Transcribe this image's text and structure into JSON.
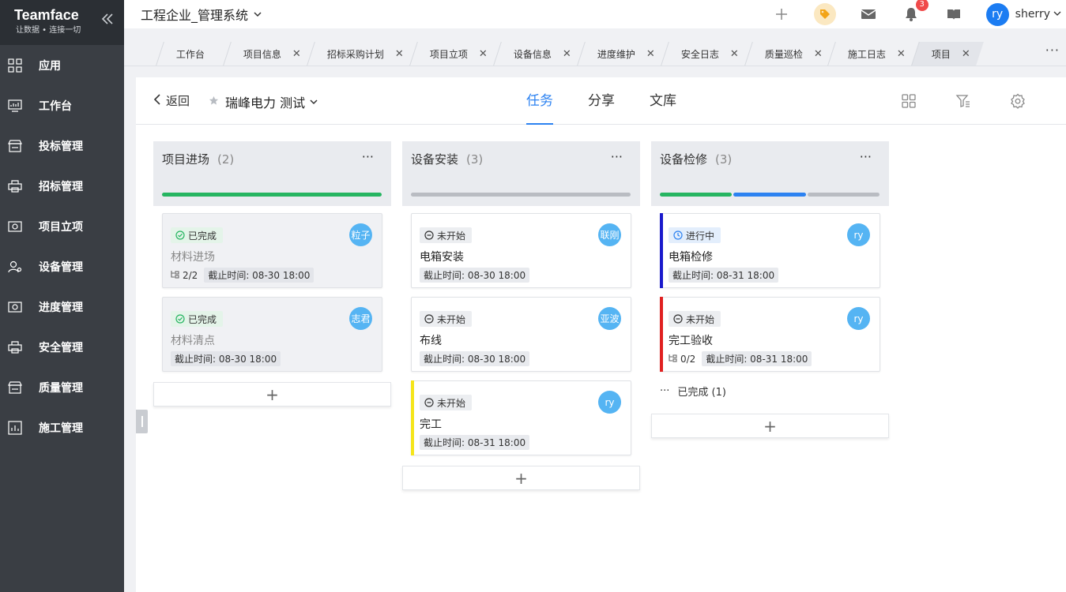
{
  "brand": {
    "name": "Teamface",
    "slogan": "让数据 • 连接一切"
  },
  "sidebar": {
    "items": [
      {
        "label": "应用",
        "icon": "grid-apps-icon"
      },
      {
        "label": "工作台",
        "icon": "dashboard-icon"
      },
      {
        "label": "投标管理",
        "icon": "storefront-icon"
      },
      {
        "label": "招标管理",
        "icon": "printer-icon"
      },
      {
        "label": "项目立项",
        "icon": "projector-icon"
      },
      {
        "label": "设备管理",
        "icon": "user-gear-icon"
      },
      {
        "label": "进度管理",
        "icon": "projector-icon"
      },
      {
        "label": "安全管理",
        "icon": "printer-icon"
      },
      {
        "label": "质量管理",
        "icon": "storefront-icon"
      },
      {
        "label": "施工管理",
        "icon": "chart-icon"
      }
    ]
  },
  "topbar": {
    "system_title": "工程企业_管理系统",
    "notification_count": "3",
    "user_initials": "ry",
    "user_name": "sherry"
  },
  "tabs": [
    {
      "label": "工作台",
      "closable": false
    },
    {
      "label": "项目信息",
      "closable": true
    },
    {
      "label": "招标采购计划",
      "closable": true
    },
    {
      "label": "项目立项",
      "closable": true
    },
    {
      "label": "设备信息",
      "closable": true
    },
    {
      "label": "进度维护",
      "closable": true
    },
    {
      "label": "安全日志",
      "closable": true
    },
    {
      "label": "质量巡检",
      "closable": true
    },
    {
      "label": "施工日志",
      "closable": true
    },
    {
      "label": "项目",
      "closable": true,
      "active": true
    }
  ],
  "tab_close_glyph": "✕",
  "panel": {
    "back_label": "返回",
    "project_name": "瑞峰电力 测试",
    "view_tabs": [
      "任务",
      "分享",
      "文库"
    ],
    "active_view": 0
  },
  "columns": [
    {
      "title": "项目进场",
      "count": "(2)",
      "progress": [
        {
          "fraction": 1.0,
          "color": "#26b561"
        }
      ],
      "cards": [
        {
          "status": "已完成",
          "status_type": "done",
          "title": "材料进场",
          "subtasks": "2/2",
          "due": "截止时间: 08-30 18:00",
          "assignee": "粒子",
          "strip": ""
        },
        {
          "status": "已完成",
          "status_type": "done",
          "title": "材料清点",
          "subtasks": "",
          "due": "截止时间: 08-30 18:00",
          "assignee": "志君",
          "strip": ""
        }
      ],
      "completed_label": ""
    },
    {
      "title": "设备安装",
      "count": "(3)",
      "progress": [
        {
          "fraction": 1.0,
          "color": "#b9bcc2"
        }
      ],
      "cards": [
        {
          "status": "未开始",
          "status_type": "todo",
          "title": "电箱安装",
          "subtasks": "",
          "due": "截止时间: 08-30 18:00",
          "assignee": "联刚",
          "strip": ""
        },
        {
          "status": "未开始",
          "status_type": "todo",
          "title": "布线",
          "subtasks": "",
          "due": "截止时间: 08-30 18:00",
          "assignee": "亚波",
          "strip": ""
        },
        {
          "status": "未开始",
          "status_type": "todo",
          "title": "完工",
          "subtasks": "",
          "due": "截止时间: 08-31 18:00",
          "assignee": "ry",
          "strip": "#f5e51a"
        }
      ],
      "completed_label": ""
    },
    {
      "title": "设备检修",
      "count": "(3)",
      "progress": [
        {
          "fraction": 0.3333,
          "color": "#26b561"
        },
        {
          "fraction": 0.3333,
          "color": "#2c82f1"
        },
        {
          "fraction": 0.3334,
          "color": "#b9bcc2"
        }
      ],
      "cards": [
        {
          "status": "进行中",
          "status_type": "doing",
          "title": "电箱检修",
          "subtasks": "",
          "due": "截止时间: 08-31 18:00",
          "assignee": "ry",
          "strip": "#1a1acc"
        },
        {
          "status": "未开始",
          "status_type": "todo",
          "title": "完工验收",
          "subtasks": "0/2",
          "due": "截止时间: 08-31 18:00",
          "assignee": "ry",
          "strip": "#e02121"
        }
      ],
      "completed_label": "已完成 (1)"
    }
  ],
  "add_glyph": "+",
  "more_glyph": "···"
}
